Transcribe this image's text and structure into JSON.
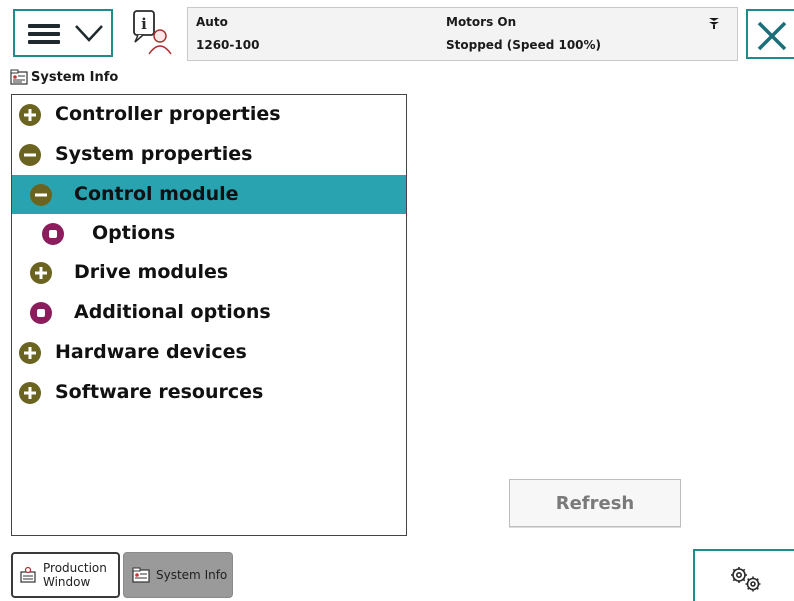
{
  "status": {
    "mode": "Auto",
    "system_name": "1260-100",
    "motors": "Motors On",
    "state": "Stopped (Speed 100%)"
  },
  "app": {
    "title": "System Info"
  },
  "tree": [
    {
      "label": "Controller properties",
      "icon": "plus-icon",
      "level": 0,
      "selected": false
    },
    {
      "label": "System properties",
      "icon": "minus-icon",
      "level": 0,
      "selected": false
    },
    {
      "label": "Control module",
      "icon": "minus-icon",
      "level": 1,
      "selected": true
    },
    {
      "label": "Options",
      "icon": "dot-icon",
      "level": 2,
      "selected": false
    },
    {
      "label": "Drive modules",
      "icon": "plus-icon",
      "level": 1,
      "selected": false
    },
    {
      "label": "Additional options",
      "icon": "dot-icon",
      "level": 1,
      "selected": false
    },
    {
      "label": "Hardware devices",
      "icon": "plus-icon",
      "level": 0,
      "selected": false
    },
    {
      "label": "Software resources",
      "icon": "plus-icon",
      "level": 0,
      "selected": false
    }
  ],
  "buttons": {
    "refresh": "Refresh"
  },
  "taskbar": {
    "production_line1": "Production",
    "production_line2": "Window",
    "system_info": "System Info"
  },
  "colors": {
    "accent": "#1c8c8c",
    "selected_row": "#2aa3b0",
    "olive_icon": "#6b6420",
    "maroon_icon": "#8a1e5d"
  }
}
